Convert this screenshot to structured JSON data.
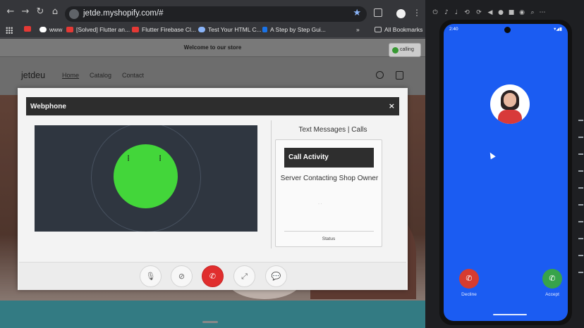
{
  "browser": {
    "url": "jetde.myshopify.com/#",
    "bookmarks": [
      {
        "label": "",
        "color": "#e53935"
      },
      {
        "label": "www",
        "color": "#ffffff"
      },
      {
        "label": "[Solved] Flutter an...",
        "color": "#e53935"
      },
      {
        "label": "Flutter Firebase Cl...",
        "color": "#e53935"
      },
      {
        "label": "Test Your HTML C...",
        "color": "#8ab4f8"
      },
      {
        "label": "A Step by Step Gui...",
        "color": "#1a73e8"
      }
    ],
    "bookmarks_more": "»",
    "all_bookmarks": "All Bookmarks"
  },
  "store": {
    "announcement": "Welcome to our store",
    "calling_badge": "calling",
    "logo": "jetdeu",
    "nav": [
      "Home",
      "Catalog",
      "Contact"
    ]
  },
  "webphone": {
    "title": "Webphone",
    "close": "×",
    "messages_title": "Text Messages | Calls",
    "call_activity": "Call Activity",
    "server_text": "Server Contacting Shop Owner",
    "tiny_dots": "· ·",
    "status_label": "Status",
    "controls": [
      {
        "name": "mic-icon",
        "glyph": "🎙"
      },
      {
        "name": "video-off-icon",
        "glyph": "⊘"
      },
      {
        "name": "end-call-icon",
        "glyph": "✆"
      },
      {
        "name": "fullscreen-icon",
        "glyph": "⤢"
      },
      {
        "name": "chat-icon",
        "glyph": "💬"
      }
    ],
    "avatar_color": "#43d63a",
    "end_call_color": "#e02e2e"
  },
  "phone": {
    "time": "2:40",
    "status_icons": "▾◢▮",
    "decline_label": "Decline",
    "accept_label": "Accept",
    "screen_color": "#1b5cf2"
  }
}
